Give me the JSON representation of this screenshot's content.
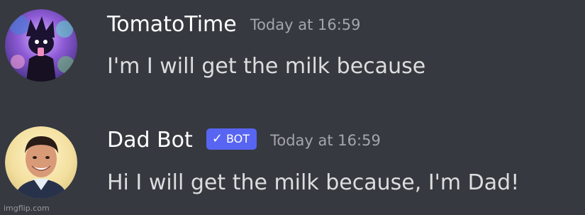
{
  "messages": [
    {
      "username": "TomatoTime",
      "timestamp": "Today at 16:59",
      "content": "I'm I will get the milk because",
      "is_bot": false,
      "avatar_icon": "purple-character-avatar",
      "username_color": "#ffffff"
    },
    {
      "username": "Dad Bot",
      "badge": "BOT",
      "badge_icon": "checkmark-icon",
      "badge_color": "#5865f2",
      "timestamp": "Today at 16:59",
      "content": "Hi I will get the milk because, I'm Dad!",
      "is_bot": true,
      "avatar_icon": "smiling-man-avatar",
      "username_color": "#ffffff"
    }
  ],
  "watermark": "imgflip.com",
  "colors": {
    "background": "#36393f",
    "text": "#dcddde",
    "timestamp": "#a3a6aa"
  }
}
